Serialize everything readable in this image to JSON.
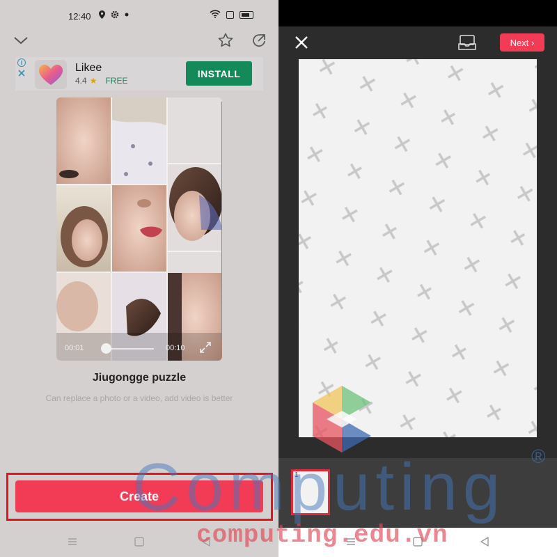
{
  "status_bar": {
    "time": "12:40"
  },
  "ad": {
    "app_name": "Likee",
    "rating": "4.4",
    "price": "FREE",
    "install_label": "INSTALL",
    "info_icon": "info-icon",
    "close_icon": "close-x-icon"
  },
  "preview": {
    "elapsed": "00:01",
    "duration": "00:10",
    "position_fraction": 0.1
  },
  "template": {
    "title": "Jiugongge puzzle",
    "subtitle": "Can replace a photo or a video, add video is better"
  },
  "create_label": "Create",
  "editor": {
    "next_label": "Next",
    "thumb_number": "1"
  },
  "watermark": {
    "word": "Computing",
    "reg": "®",
    "url": "computing.edu.vn"
  },
  "colors": {
    "accent": "#f23b55",
    "install_green": "#148a5b",
    "highlight_red": "#e6121f",
    "editor_bg": "#2c2c2c"
  }
}
